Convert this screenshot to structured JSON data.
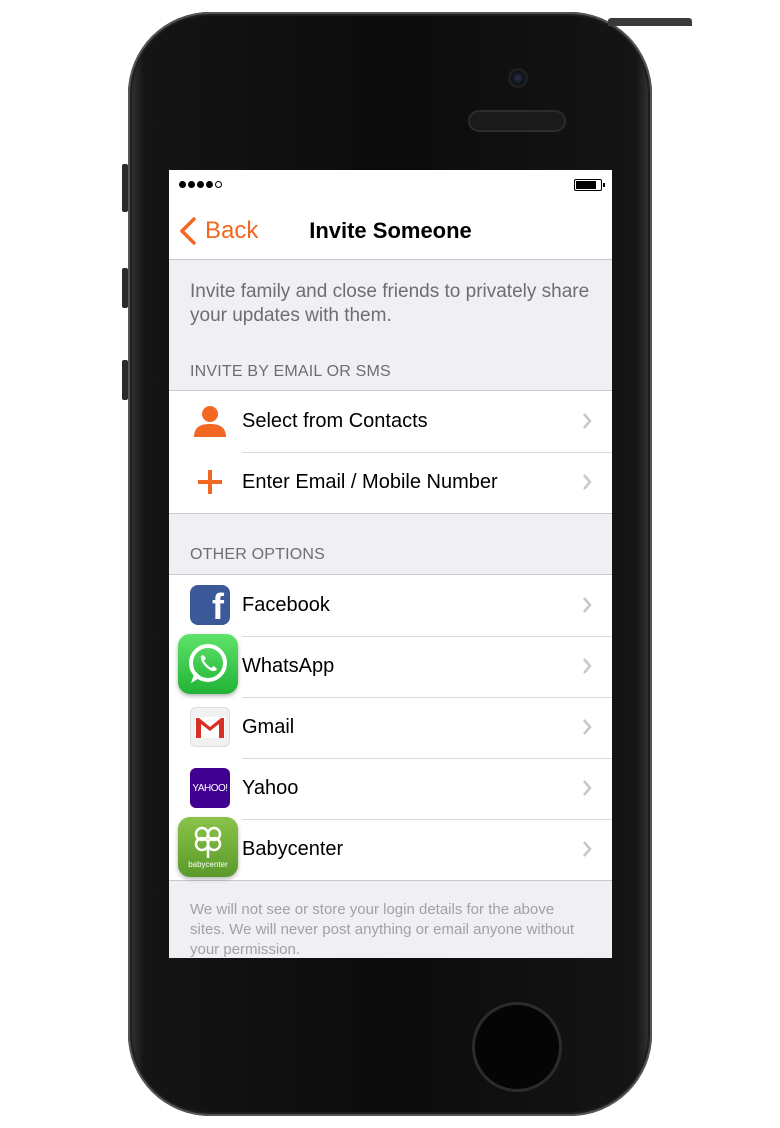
{
  "status": {
    "signal_dots": 4,
    "signal_total": 5,
    "battery_level": 0.8
  },
  "nav": {
    "back_label": "Back",
    "title": "Invite Someone"
  },
  "intro": "Invite family and close friends to privately share your updates with them.",
  "section_email": {
    "header": "INVITE BY EMAIL OR SMS",
    "items": [
      {
        "label": "Select from Contacts",
        "icon": "person-icon"
      },
      {
        "label": "Enter Email / Mobile Number",
        "icon": "plus-icon"
      }
    ]
  },
  "section_other": {
    "header": "OTHER OPTIONS",
    "items": [
      {
        "label": "Facebook",
        "icon": "facebook-icon"
      },
      {
        "label": "WhatsApp",
        "icon": "whatsapp-icon"
      },
      {
        "label": "Gmail",
        "icon": "gmail-icon"
      },
      {
        "label": "Yahoo",
        "icon": "yahoo-icon",
        "icon_text": "YAHOO!"
      },
      {
        "label": "Babycenter",
        "icon": "babycenter-icon",
        "icon_text": "babycenter"
      }
    ]
  },
  "footer_note": "We will not see or store your login details for the above sites. We will never post anything or email anyone without your permission.",
  "colors": {
    "accent": "#f26722",
    "facebook": "#3b5998",
    "yahoo": "#400090",
    "whatsapp": "#25d366",
    "babycenter": "#7bb342"
  }
}
